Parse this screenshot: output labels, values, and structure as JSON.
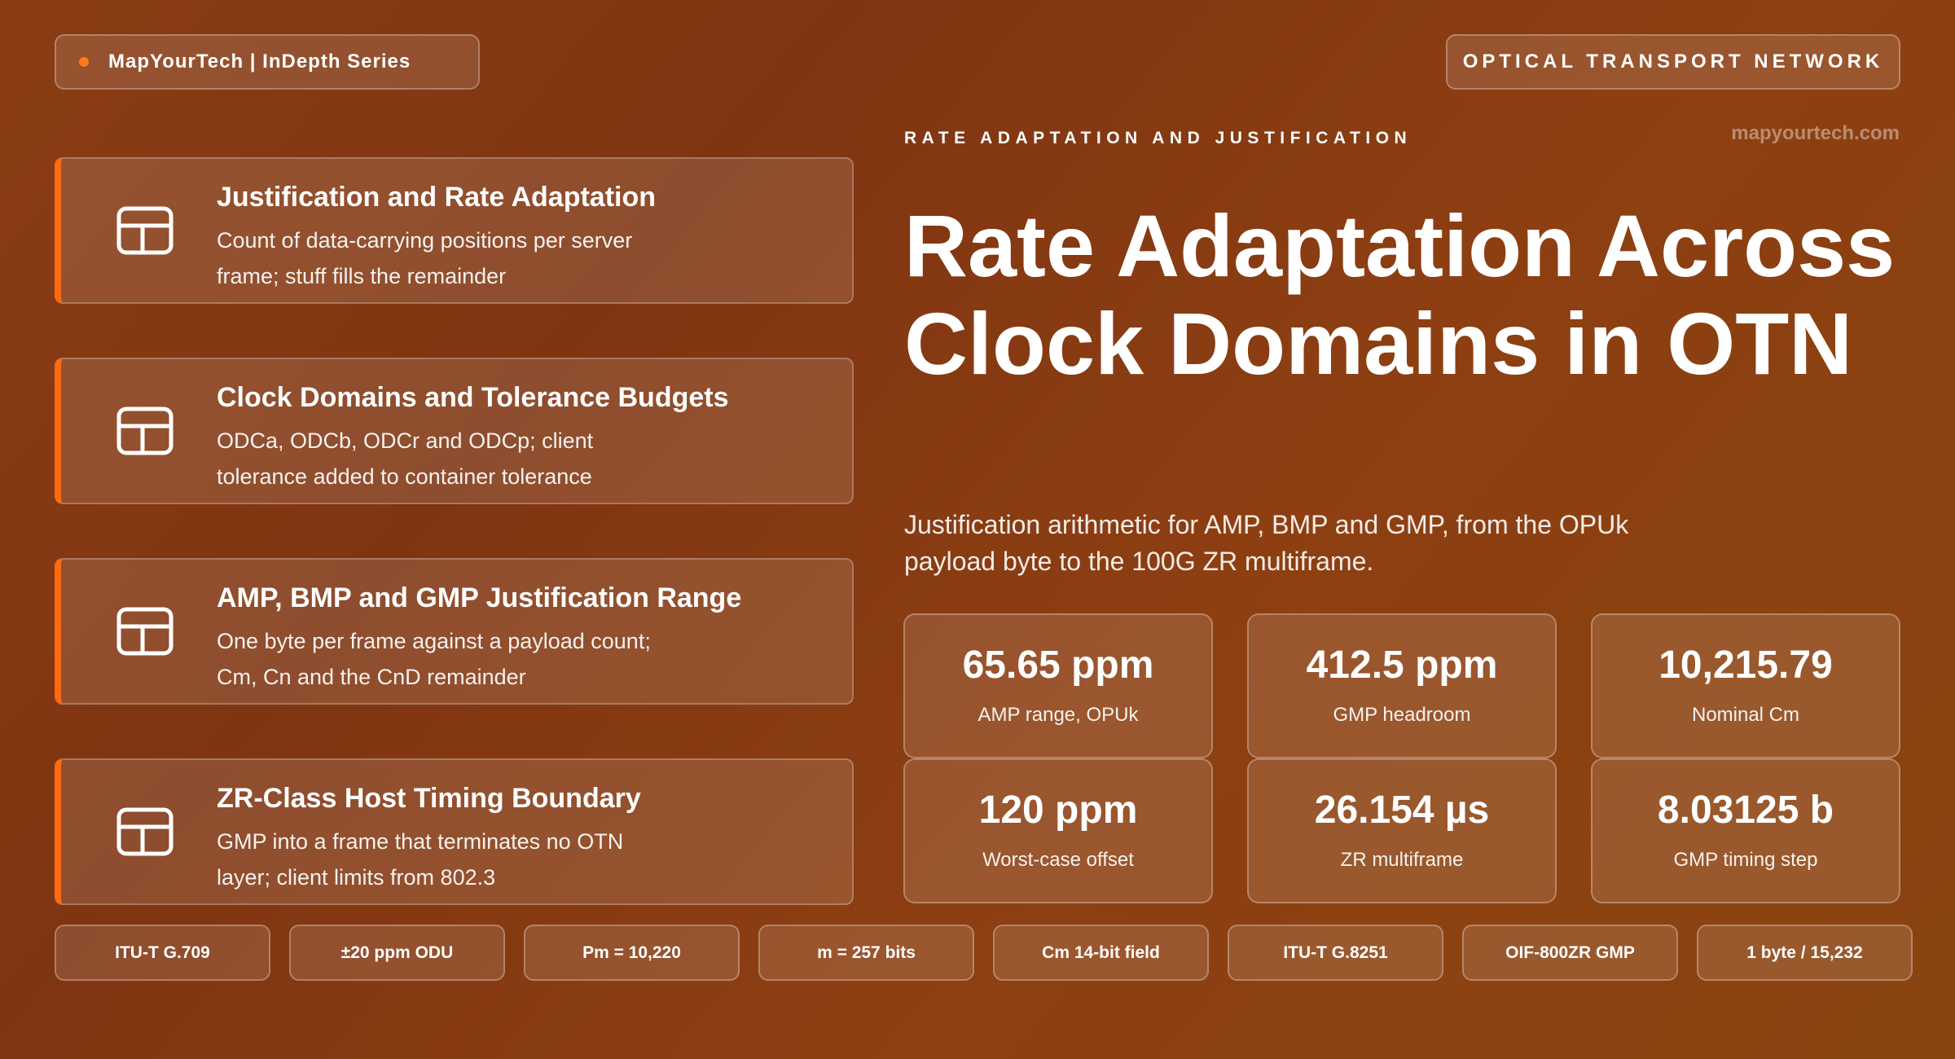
{
  "header": {
    "brand": "MapYourTech | InDepth Series",
    "section": "OPTICAL TRANSPORT NETWORK",
    "eyebrow": "RATE ADAPTATION AND JUSTIFICATION",
    "site": "mapyourtech.com"
  },
  "hero": {
    "title": "Rate Adaptation Across Clock Domains in OTN",
    "subtitle": "Justification arithmetic for AMP, BMP and GMP, from the OPUk payload byte to the 100G ZR multiframe."
  },
  "topics": [
    {
      "title": "Justification and Rate Adaptation",
      "desc": "Count of data-carrying positions per server frame; stuff fills the remainder",
      "icon": "table-icon"
    },
    {
      "title": "Clock Domains and Tolerance Budgets",
      "desc": "ODCa, ODCb, ODCr and ODCp; client tolerance added to container tolerance",
      "icon": "table-icon"
    },
    {
      "title": "AMP, BMP and GMP Justification Range",
      "desc": "One byte per frame against a payload count; Cm, Cn and the CnD remainder",
      "icon": "table-icon"
    },
    {
      "title": "ZR-Class Host Timing Boundary",
      "desc": "GMP into a frame that terminates no OTN layer; client limits from 802.3",
      "icon": "table-icon"
    }
  ],
  "stats": [
    {
      "value": "65.65 ppm",
      "label": "AMP range, OPUk"
    },
    {
      "value": "412.5 ppm",
      "label": "GMP headroom"
    },
    {
      "value": "10,215.79",
      "label": "Nominal Cm"
    },
    {
      "value": "120 ppm",
      "label": "Worst-case offset"
    },
    {
      "value": "26.154 µs",
      "label": "ZR multiframe"
    },
    {
      "value": "8.03125 b",
      "label": "GMP timing step"
    }
  ],
  "chips": [
    "ITU-T G.709",
    "±20 ppm ODU",
    "Pm = 10,220",
    "m = 257 bits",
    "Cm 14-bit field",
    "ITU-T G.8251",
    "OIF-800ZR GMP",
    "1 byte / 15,232"
  ],
  "colors": {
    "accent": "#ff6a12",
    "dot": "#ff7a1a"
  }
}
